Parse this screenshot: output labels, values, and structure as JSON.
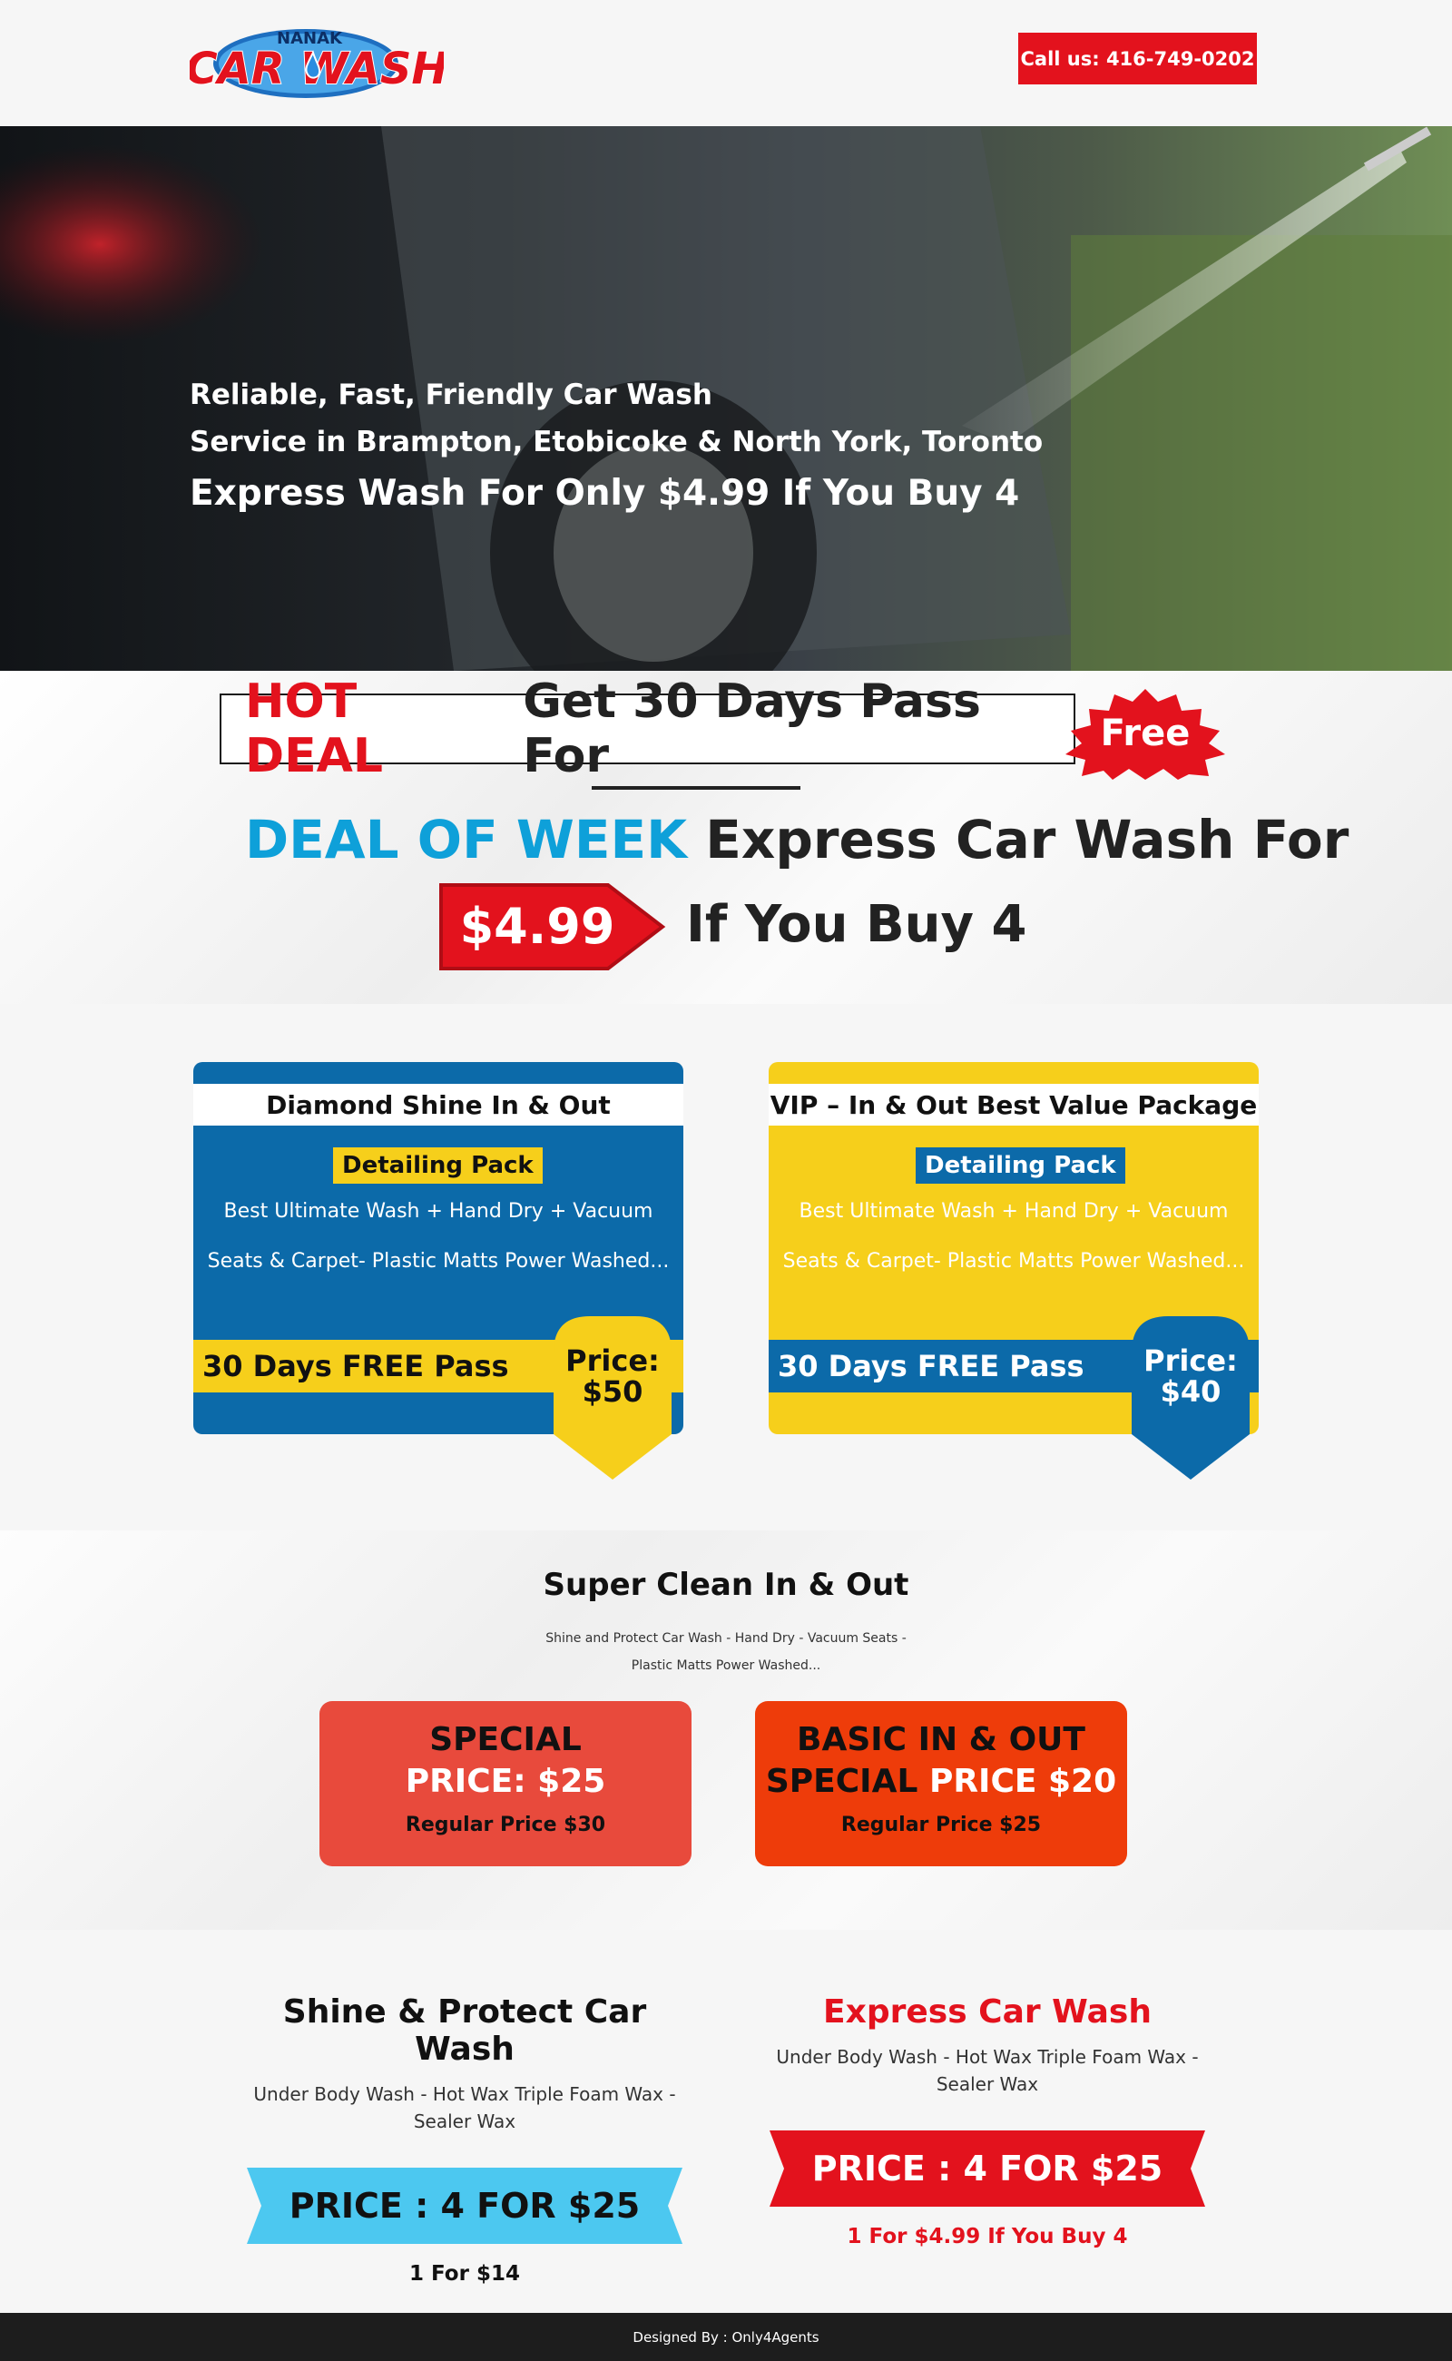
{
  "header": {
    "logo_small": "NANAK",
    "logo_main": "CAR WASH",
    "call_label": "Call us: 416-749-0202"
  },
  "hero": {
    "line1": "Reliable, Fast, Friendly Car Wash",
    "line2": "Service in Brampton, Etobicoke & North York, Toronto",
    "offer": "Express Wash For Only $4.99 If You Buy 4"
  },
  "deal": {
    "hot_label": "HOT DEAL",
    "hot_rest": "Get 30 Days Pass For",
    "free_label": "Free",
    "dow_label": "DEAL OF WEEK",
    "dow_rest": "Express Car Wash For",
    "price": "$4.99",
    "if_buy": "If You Buy 4"
  },
  "packages": [
    {
      "title": "Diamond Shine In & Out",
      "tag": "Detailing Pack",
      "line1": "Best Ultimate Wash + Hand Dry + Vacuum",
      "line2": "Seats & Carpet- Plastic Matts Power Washed...",
      "band": "30 Days FREE Pass",
      "price_label": "Price:",
      "price": "$50"
    },
    {
      "title": "VIP – In & Out Best Value Package",
      "tag": "Detailing Pack",
      "line1": "Best Ultimate Wash + Hand Dry + Vacuum",
      "line2": "Seats & Carpet- Plastic Matts Power Washed...",
      "band": "30 Days FREE Pass",
      "price_label": "Price:",
      "price": "$40"
    }
  ],
  "super": {
    "title": "Super Clean In & Out",
    "desc": "Shine and Protect Car Wash - Hand Dry - Vacuum Seats - Plastic Matts Power Washed...",
    "cards": [
      {
        "h1": "SPECIAL",
        "h2": "PRICE: $25",
        "regular": "Regular Price $30"
      },
      {
        "h1": "BASIC IN & OUT",
        "h2_dark": "SPECIAL",
        "h2": "PRICE $20",
        "regular": "Regular Price $25"
      }
    ]
  },
  "offers": [
    {
      "title": "Shine & Protect Car Wash",
      "desc": "Under Body Wash - Hot Wax Triple Foam Wax - Sealer Wax",
      "ribbon": "PRICE : 4 FOR $25",
      "sub": "1 For $14"
    },
    {
      "title": "Express Car Wash",
      "desc": "Under Body Wash - Hot Wax Triple Foam Wax - Sealer Wax",
      "ribbon": "PRICE : 4 FOR $25",
      "sub": "1 For $4.99 If You Buy 4"
    }
  ],
  "footer": {
    "text": "Designed By : Only4Agents"
  },
  "colors": {
    "brand_red": "#e3121d",
    "brand_blue": "#0c6aa9",
    "brand_yellow": "#f6cf1b",
    "accent_cyan": "#0ea0d9",
    "ribbon_cyan": "#4cc8f0"
  },
  "icons": [
    "water-drop-icon",
    "water-spray-icon"
  ]
}
